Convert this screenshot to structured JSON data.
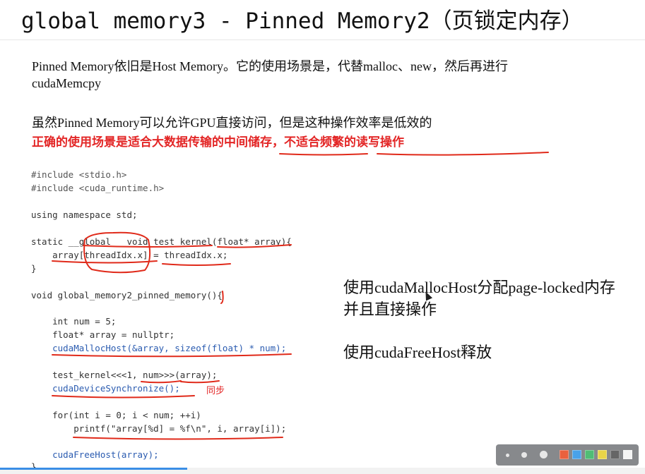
{
  "slide": {
    "title": "global memory3 - Pinned Memory2（页锁定内存）",
    "paragraph1_line1": "Pinned Memory依旧是Host Memory。它的使用场景是，代替malloc、new，然后再进行",
    "paragraph1_line2": "cudaMemcpy",
    "paragraph2_line1": "虽然Pinned Memory可以允许GPU直接访问，但是这种操作效率是低效的",
    "paragraph2_line2": "正确的使用场景是适合大数据传输的中间储存，不适合频繁的读写操作",
    "side_note1_line1": "使用cudaMallocHost分配page-locked内存",
    "side_note1_line2": "并且直接操作",
    "side_note2": "使用cudaFreeHost释放",
    "handwritten_note": "同步"
  },
  "code": {
    "include1": "#include <stdio.h>",
    "include2": "#include <cuda_runtime.h>",
    "using": "using namespace std;",
    "kernel_sig": "static __global__ void test_kernel(float* array){",
    "kernel_body": "    array[threadIdx.x] = threadIdx.x;",
    "kernel_end": "}",
    "func_sig": "void global_memory2_pinned_memory(){",
    "line_num": "    int num = 5;",
    "line_ptr": "    float* array = nullptr;",
    "line_malloc": "    cudaMallocHost(&array, sizeof(float) * num);",
    "line_launch": "    test_kernel<<<1, num>>>(array);",
    "line_sync": "    cudaDeviceSynchronize();",
    "line_for": "    for(int i = 0; i < num; ++i)",
    "line_printf": "        printf(\"array[%d] = %f\\n\", i, array[i]);",
    "line_free": "    cudaFreeHost(array);",
    "func_end": "}"
  },
  "toolbar": {
    "swatch_colors": [
      "#e8542e",
      "#3a9be8",
      "#42b86a",
      "#e8d23a",
      "#5a5a5a",
      "#f4f4f4"
    ]
  },
  "progress": {
    "fraction": 0.29
  }
}
